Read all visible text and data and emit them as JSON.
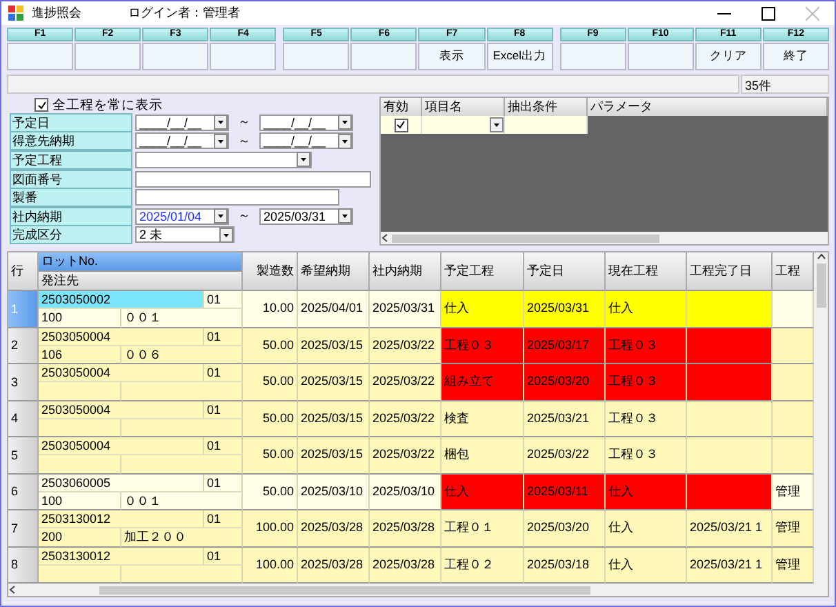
{
  "window": {
    "title": "進捗照会",
    "user_label": "ログイン者：管理者"
  },
  "function_keys": [
    {
      "key": "F1"
    },
    {
      "key": "F2"
    },
    {
      "key": "F3"
    },
    {
      "key": "F4"
    },
    {
      "key": "F5"
    },
    {
      "key": "F6"
    },
    {
      "key": "F7",
      "label": "表示"
    },
    {
      "key": "F8",
      "label": "Excel出力"
    },
    {
      "key": "F9"
    },
    {
      "key": "F10"
    },
    {
      "key": "F11",
      "label": "クリア"
    },
    {
      "key": "F12",
      "label": "終了"
    }
  ],
  "status_bar": {
    "count": "35件"
  },
  "filter": {
    "show_all_processes": {
      "label": "全工程を常に表示",
      "checked": true
    },
    "fields": [
      {
        "label": "予定日",
        "kind": "date_range",
        "from": {
          "value": "____/__/__",
          "focused": false
        },
        "separator": "～",
        "to": {
          "value": "____/__/__",
          "focused": false
        }
      },
      {
        "label": "得意先納期",
        "kind": "date_range",
        "from": {
          "value": "____/__/__",
          "focused": false
        },
        "separator": "～",
        "to": {
          "value": "____/__/__",
          "focused": false
        }
      },
      {
        "label": "予定工程",
        "kind": "combo"
      },
      {
        "label": "図面番号",
        "kind": "text_wide"
      },
      {
        "label": "製番",
        "kind": "text"
      },
      {
        "label": "社内納期",
        "kind": "date_range",
        "from": {
          "value": "2025/01/04",
          "focused": true
        },
        "separator": "～",
        "to": {
          "value": "2025/03/31",
          "focused": false
        }
      },
      {
        "label": "完成区分",
        "kind": "combo_short",
        "value": "2 未"
      }
    ]
  },
  "condition_grid": {
    "columns": [
      "有効",
      "項目名",
      "抽出条件",
      "パラメータ"
    ],
    "rows": [
      {
        "enabled": true
      }
    ]
  },
  "grid": {
    "row_header": "行",
    "lot_header": "ロットNo.",
    "supplier_header": "発注先",
    "columns": [
      "製造数",
      "希望納期",
      "社内納期",
      "予定工程",
      "予定日",
      "現在工程",
      "工程完了日",
      "工程"
    ],
    "rows": [
      {
        "no": "1",
        "selected": true,
        "pale": true,
        "color": "#ffff00",
        "lot": "2503050002",
        "branch": "01",
        "supplier_code": "100",
        "supplier_name": "００１",
        "quantity": "10.00",
        "requested_date": "2025/04/01",
        "internal_date": "2025/03/31",
        "planned_process": "仕入",
        "planned_date": "2025/03/31",
        "current_process": "仕入"
      },
      {
        "no": "2",
        "selected": false,
        "pale": false,
        "color": "#ff0000",
        "lot": "2503050004",
        "branch": "01",
        "supplier_code": "106",
        "supplier_name": "００６",
        "quantity": "50.00",
        "requested_date": "2025/03/15",
        "internal_date": "2025/03/22",
        "planned_process": "工程０３",
        "planned_date": "2025/03/17",
        "current_process": "工程０３"
      },
      {
        "no": "3",
        "selected": false,
        "pale": false,
        "color": "#ff0000",
        "lot": "2503050004",
        "branch": "01",
        "quantity": "50.00",
        "requested_date": "2025/03/15",
        "internal_date": "2025/03/22",
        "planned_process": "組み立て",
        "planned_date": "2025/03/20",
        "current_process": "工程０３"
      },
      {
        "no": "4",
        "selected": false,
        "pale": false,
        "lot": "2503050004",
        "branch": "01",
        "quantity": "50.00",
        "requested_date": "2025/03/15",
        "internal_date": "2025/03/22",
        "planned_process": "検査",
        "planned_date": "2025/03/21",
        "current_process": "工程０３"
      },
      {
        "no": "5",
        "selected": false,
        "pale": false,
        "lot": "2503050004",
        "branch": "01",
        "quantity": "50.00",
        "requested_date": "2025/03/15",
        "internal_date": "2025/03/22",
        "planned_process": "梱包",
        "planned_date": "2025/03/22",
        "current_process": "工程０３"
      },
      {
        "no": "6",
        "selected": false,
        "pale": true,
        "color": "#ff0000",
        "lot": "2503060005",
        "branch": "01",
        "supplier_code": "100",
        "supplier_name": "００１",
        "quantity": "50.00",
        "requested_date": "2025/03/10",
        "internal_date": "2025/03/10",
        "planned_process": "仕入",
        "planned_date": "2025/03/11",
        "current_process": "仕入",
        "last": "管理"
      },
      {
        "no": "7",
        "selected": false,
        "pale": false,
        "lot": "2503130012",
        "branch": "01",
        "supplier_code": "200",
        "supplier_name": "加工２００",
        "quantity": "100.00",
        "requested_date": "2025/03/28",
        "internal_date": "2025/03/28",
        "planned_process": "工程０１",
        "planned_date": "2025/03/20",
        "current_process": "仕入",
        "completed_date": "2025/03/21 1",
        "last": "管理"
      },
      {
        "no": "8",
        "selected": false,
        "pale": false,
        "lot": "2503130012",
        "branch": "01",
        "quantity": "100.00",
        "requested_date": "2025/03/28",
        "internal_date": "2025/03/28",
        "planned_process": "工程０２",
        "planned_date": "2025/03/18",
        "current_process": "仕入",
        "completed_date": "2025/03/21 1",
        "last": "管理"
      }
    ]
  }
}
